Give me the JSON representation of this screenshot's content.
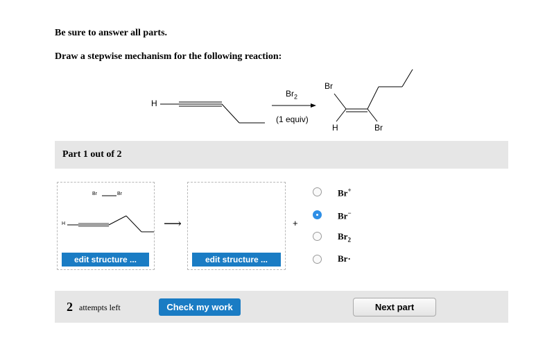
{
  "instructions": {
    "line1": "Be sure to answer all parts.",
    "line2": "Draw a stepwise mechanism for the following reaction:"
  },
  "reaction": {
    "reactant_h": "H",
    "reagent": "Br",
    "reagent_sub": "2",
    "condition": "(1 equiv)",
    "product_br_top": "Br",
    "product_h": "H",
    "product_br_bottom": "Br"
  },
  "part": {
    "title": "Part 1 out of 2"
  },
  "box1": {
    "br_left": "Br",
    "br_right": "Br",
    "h_label": "H",
    "edit_label": "edit structure ..."
  },
  "box2": {
    "edit_label": "edit structure ..."
  },
  "arrow": "⟶",
  "plus": "+",
  "options": [
    {
      "base": "Br",
      "sup": "+",
      "sub": "",
      "selected": false
    },
    {
      "base": "Br",
      "sup": "−",
      "sub": "",
      "selected": true
    },
    {
      "base": "Br",
      "sup": "",
      "sub": "2",
      "selected": false
    },
    {
      "base": "Br·",
      "sup": "",
      "sub": "",
      "selected": false
    }
  ],
  "footer": {
    "attempts_count": "2",
    "attempts_label": "attempts left",
    "check_label": "Check my work",
    "next_label": "Next part"
  },
  "colors": {
    "accent": "#1a7cc4",
    "radio_selected": "#2f8fe6",
    "bar_bg": "#e6e6e6"
  }
}
